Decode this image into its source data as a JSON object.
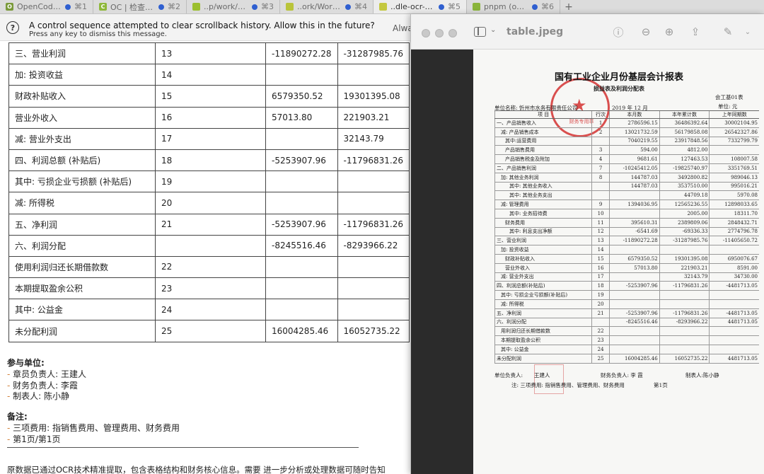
{
  "tabs": [
    {
      "title": "OpenCode (...",
      "shortcut": "⌘1",
      "icon_color": "#7a9a3a",
      "icon_glyph": "O",
      "active": false
    },
    {
      "title": "OC | 检查 O...",
      "shortcut": "⌘2",
      "icon_color": "#8fb83a",
      "icon_glyph": "C",
      "active": false
    },
    {
      "title": "..p/work/yol...",
      "shortcut": "⌘3",
      "icon_color": "#9bbf2e",
      "icon_glyph": "",
      "active": false
    },
    {
      "title": "..ork/WorkA...",
      "shortcut": "⌘4",
      "icon_color": "#b9c43a",
      "icon_glyph": "",
      "active": false
    },
    {
      "title": "..dle-ocr-skill (...",
      "shortcut": "⌘5",
      "icon_color": "#c4c840",
      "icon_glyph": "",
      "active": true
    },
    {
      "title": "pnpm (opencla...",
      "shortcut": "⌘6",
      "icon_color": "#8ab43a",
      "icon_glyph": "",
      "active": false
    }
  ],
  "notice": {
    "title": "A control sequence attempted to clear scrollback history. Allow this in the future?",
    "subtitle": "Press any key to dismiss this message.",
    "button": "Alwa"
  },
  "result_table": [
    [
      "三、营业利润",
      "13",
      "-11890272.28",
      "-31287985.76"
    ],
    [
      "加: 投资收益",
      "14",
      "",
      ""
    ],
    [
      "财政补贴收入",
      "15",
      "6579350.52",
      "19301395.08"
    ],
    [
      "营业外收入",
      "16",
      "57013.80",
      "221903.21"
    ],
    [
      "减: 营业外支出",
      "17",
      "",
      "32143.79"
    ],
    [
      "四、利润总额 (补贴后)",
      "18",
      "-5253907.96",
      "-11796831.26"
    ],
    [
      "其中: 亏损企业亏损额 (补贴后)",
      "19",
      "",
      ""
    ],
    [
      "减: 所得税",
      "20",
      "",
      ""
    ],
    [
      "五、净利润",
      "21",
      "-5253907.96",
      "-11796831.26"
    ],
    [
      "六、利润分配",
      "",
      "-8245516.46",
      "-8293966.22"
    ],
    [
      "使用利润归还长期借款数",
      "22",
      "",
      ""
    ],
    [
      "本期提取盈余公积",
      "23",
      "",
      ""
    ],
    [
      "其中: 公益金",
      "24",
      "",
      ""
    ],
    [
      "未分配利润",
      "25",
      "16004285.46",
      "16052735.22"
    ]
  ],
  "participants": {
    "heading": "参与单位:",
    "items": [
      "章员负责人: 王建人",
      "财务负责人: 李霞",
      "制表人: 陈小静"
    ]
  },
  "notes": {
    "heading": "备注:",
    "items": [
      "三项费用: 指销售费用、管理费用、财务费用",
      "第1页/第1页"
    ]
  },
  "footer_text": "原数据已通过OCR技术精准提取，包含表格结构和财务核心信息。需要 进一步分析或处理数据可随时告知",
  "preview": {
    "file_title": "table.jpeg",
    "doc_title": "国有工业企业月份基层会计报表",
    "doc_subtitle": "损益表及利润分配表",
    "form_code": "会工基01表",
    "unit_label": "单位:  元",
    "org_label": "单位名称: 忻州市水务有限责任公司",
    "date_label": "2019 年 12 月",
    "headers": [
      "项    目",
      "行次",
      "本月数",
      "本年累计数",
      "上年同期数"
    ],
    "rows": [
      {
        "label": "一、产品销售收入",
        "indent": 0,
        "row": "1",
        "month": "2786596.15",
        "ytd": "36486392.64",
        "prior": "30002104.95"
      },
      {
        "label": "减: 产品销售成本",
        "indent": 1,
        "row": "2",
        "month": "13021732.59",
        "ytd": "56179858.08",
        "prior": "26542327.86"
      },
      {
        "label": "其中:运营费用",
        "indent": 2,
        "row": "",
        "month": "7040219.55",
        "ytd": "23917848.56",
        "prior": "7332799.79"
      },
      {
        "label": "产品销售费用",
        "indent": 2,
        "row": "3",
        "month": "594.00",
        "ytd": "4812.00",
        "prior": ""
      },
      {
        "label": "产品销售税金及附加",
        "indent": 2,
        "row": "4",
        "month": "9681.61",
        "ytd": "127463.53",
        "prior": "108007.58"
      },
      {
        "label": "二、产品销售利润",
        "indent": 0,
        "row": "7",
        "month": "-10245412.05",
        "ytd": "-19825740.97",
        "prior": "3351769.51"
      },
      {
        "label": "加: 其他业务利润",
        "indent": 1,
        "row": "8",
        "month": "144787.03",
        "ytd": "3492800.82",
        "prior": "989046.13"
      },
      {
        "label": "其中: 其他业务收入",
        "indent": 3,
        "row": "",
        "month": "144787.03",
        "ytd": "3537510.00",
        "prior": "995016.21"
      },
      {
        "label": "其中: 其他业务支出",
        "indent": 3,
        "row": "",
        "month": "",
        "ytd": "44709.18",
        "prior": "5970.08"
      },
      {
        "label": "减: 管理费用",
        "indent": 1,
        "row": "9",
        "month": "1394036.95",
        "ytd": "12565236.55",
        "prior": "12898033.65"
      },
      {
        "label": "其中: 业务招待费",
        "indent": 3,
        "row": "10",
        "month": "",
        "ytd": "2005.00",
        "prior": "18311.70"
      },
      {
        "label": "财务费用",
        "indent": 2,
        "row": "11",
        "month": "395610.31",
        "ytd": "2389809.06",
        "prior": "2848432.71"
      },
      {
        "label": "其中: 利息支出净额",
        "indent": 3,
        "row": "12",
        "month": "-6541.69",
        "ytd": "-69336.33",
        "prior": "2774796.78"
      },
      {
        "label": "三、营业利润",
        "indent": 0,
        "row": "13",
        "month": "-11890272.28",
        "ytd": "-31287985.76",
        "prior": "-11405650.72"
      },
      {
        "label": "加: 投资收益",
        "indent": 1,
        "row": "14",
        "month": "",
        "ytd": "",
        "prior": ""
      },
      {
        "label": "财政补贴收入",
        "indent": 2,
        "row": "15",
        "month": "6579350.52",
        "ytd": "19301395.08",
        "prior": "6950076.67"
      },
      {
        "label": "营业外收入",
        "indent": 2,
        "row": "16",
        "month": "57013.80",
        "ytd": "221903.21",
        "prior": "8591.00"
      },
      {
        "label": "减: 营业外支出",
        "indent": 1,
        "row": "17",
        "month": "",
        "ytd": "32143.79",
        "prior": "34730.00"
      },
      {
        "label": "四、利润总额(补贴后)",
        "indent": 0,
        "row": "18",
        "month": "-5253907.96",
        "ytd": "-11796831.26",
        "prior": "-4481713.05"
      },
      {
        "label": "其中: 亏损企业亏损额(补贴后)",
        "indent": 1,
        "row": "19",
        "month": "",
        "ytd": "",
        "prior": ""
      },
      {
        "label": "减: 所得税",
        "indent": 1,
        "row": "20",
        "month": "",
        "ytd": "",
        "prior": ""
      },
      {
        "label": "五、净利润",
        "indent": 0,
        "row": "21",
        "month": "-5253907.96",
        "ytd": "-11796831.26",
        "prior": "-4481713.05"
      },
      {
        "label": "六、利润分配",
        "indent": 0,
        "row": "",
        "month": "-8245516.46",
        "ytd": "-8293966.22",
        "prior": "4481713.05"
      },
      {
        "label": "用利润归还长期借款数",
        "indent": 1,
        "row": "22",
        "month": "",
        "ytd": "",
        "prior": ""
      },
      {
        "label": "本期提取盈余公积",
        "indent": 1,
        "row": "23",
        "month": "",
        "ytd": "",
        "prior": ""
      },
      {
        "label": "其中: 公益金",
        "indent": 1,
        "row": "24",
        "month": "",
        "ytd": "",
        "prior": ""
      },
      {
        "label": "未分配利润",
        "indent": 0,
        "row": "25",
        "month": "16004285.46",
        "ytd": "16052735.22",
        "prior": "4481713.05"
      }
    ],
    "sign_unit": "单位负责人:",
    "sign_unit_name": "王建人",
    "sign_finance": "财务负责人: 李 霞",
    "sign_maker": "制表人:陈小静",
    "doc_note": "注: 三项费用: 指销售费用、管理费用、财务费用",
    "page": "第1页",
    "seal_text": "财务专用章"
  }
}
